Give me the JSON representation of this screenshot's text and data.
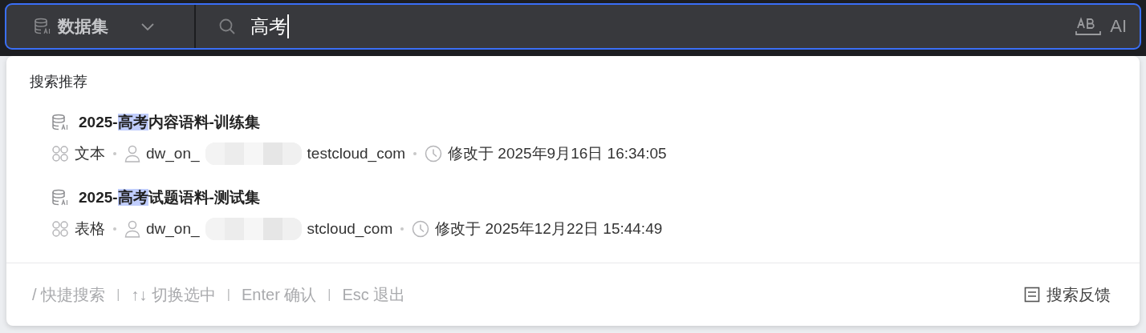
{
  "search_bar": {
    "scope": "数据集",
    "query": "高考",
    "right_actions": [
      "AI"
    ]
  },
  "suggestions": {
    "heading": "搜索推荐",
    "items": [
      {
        "title": [
          {
            "text": "2025-",
            "highlighted": false
          },
          {
            "text": "高考",
            "highlighted": true
          },
          {
            "text": "内容语料-训练集",
            "highlighted": false
          }
        ],
        "type": "文本",
        "owner_prefix": "dw_on_",
        "owner_suffix": "testcloud_com",
        "modified": "修改于 2025年9月16日 16:34:05"
      },
      {
        "title": [
          {
            "text": "2025-",
            "highlighted": false
          },
          {
            "text": "高考",
            "highlighted": true
          },
          {
            "text": "试题语料-测试集",
            "highlighted": false
          }
        ],
        "type": "表格",
        "owner_prefix": "dw_on_",
        "owner_suffix": "stcloud_com",
        "modified": "修改于 2025年12月22日 15:44:49"
      }
    ]
  },
  "footer": {
    "hints": [
      "/ 快捷搜索",
      "↑↓ 切换选中",
      "Enter 确认",
      "Esc 退出"
    ],
    "separator": "|",
    "feedback": "搜索反馈"
  }
}
